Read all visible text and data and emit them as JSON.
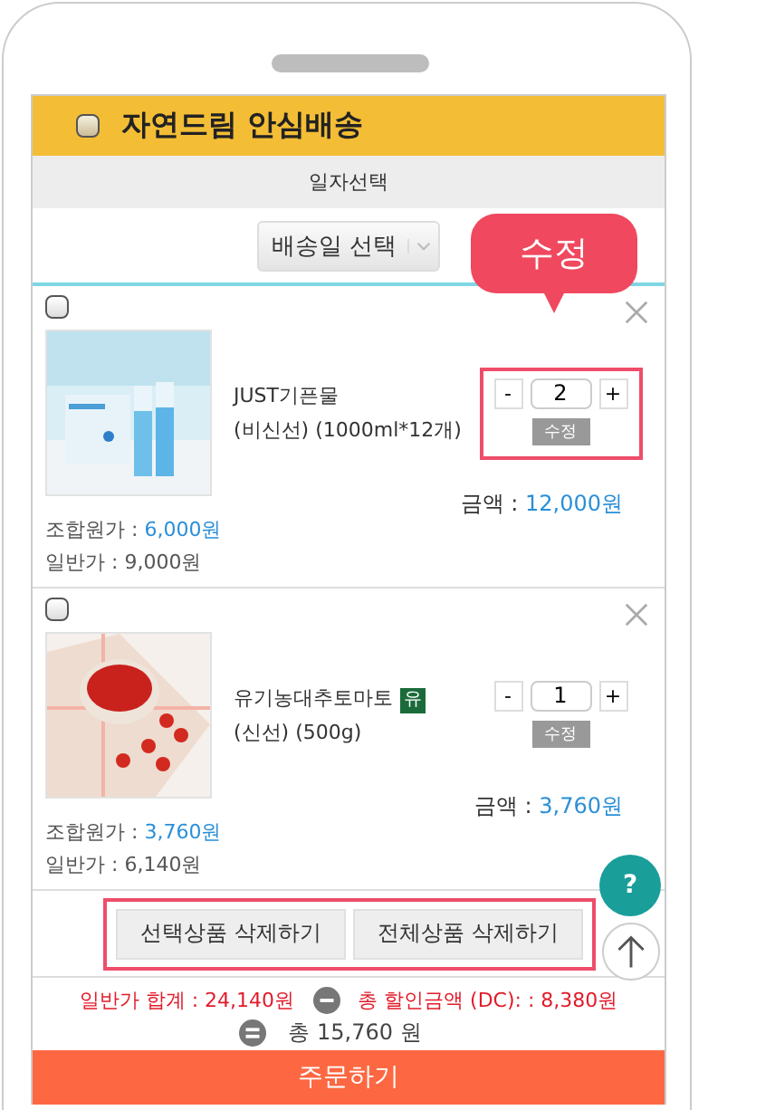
{
  "header": {
    "checked": false,
    "title": "자연드림 안심배송"
  },
  "date_section": {
    "label": "일자선택",
    "select": "배송일 선택"
  },
  "callout": "수정",
  "items": [
    {
      "checked": false,
      "name_line1": "JUST기픈물",
      "name_line2": "(비신선) (1000ml*12개)",
      "quantity": "2",
      "minus": "-",
      "plus": "+",
      "update_button": "수정",
      "highlighted": true,
      "amount_label": "금액 :",
      "amount": "12,000원",
      "member_label": "조합원가 :",
      "member_price": "6,000원",
      "regular_price": "일반가 : 9,000원"
    },
    {
      "checked": false,
      "name_line1": "유기농대추토마토",
      "badge": "유",
      "name_line2": "(신선) (500g)",
      "quantity": "1",
      "minus": "-",
      "plus": "+",
      "update_button": "수정",
      "highlighted": false,
      "amount_label": "금액 :",
      "amount": "3,760원",
      "member_label": "조합원가 :",
      "member_price": "3,760원",
      "regular_price": "일반가 : 6,140원"
    }
  ],
  "help_button": "?",
  "delete_buttons": {
    "highlighted": true,
    "labels": [
      "선택상품 삭제하기",
      "전체상품 삭제하기"
    ]
  },
  "totals": {
    "regular_total": "일반가 합계 : 24,140원",
    "discount": "총 할인금액 (DC): : 8,380원",
    "total": "총 15,760 원"
  },
  "order_button": "주문하기"
}
